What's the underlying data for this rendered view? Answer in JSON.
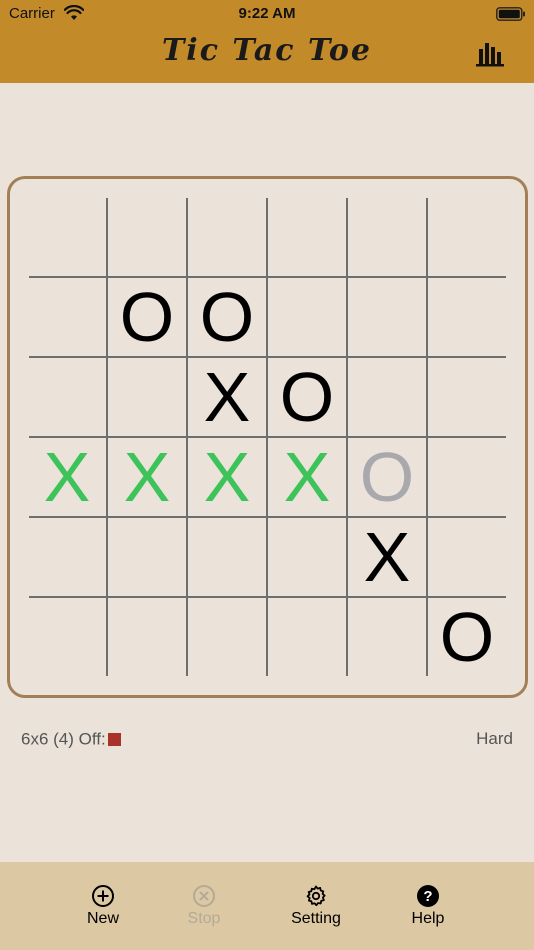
{
  "status_bar": {
    "carrier": "Carrier",
    "time": "9:22 AM"
  },
  "header": {
    "title": "Tic Tac Toe",
    "stats_icon": "bar-chart-icon",
    "background": "#c38a2a"
  },
  "board": {
    "size": 6,
    "cells": [
      [
        "",
        "",
        "",
        "",
        "",
        ""
      ],
      [
        "",
        "O",
        "O",
        "",
        "",
        ""
      ],
      [
        "",
        "",
        "X",
        "O",
        "",
        ""
      ],
      [
        "X",
        "X",
        "X",
        "X",
        "O",
        ""
      ],
      [
        "",
        "",
        "",
        "",
        "X",
        ""
      ],
      [
        "",
        "",
        "",
        "",
        "",
        "O"
      ]
    ],
    "highlight": [
      [
        3,
        0
      ],
      [
        3,
        1
      ],
      [
        3,
        2
      ],
      [
        3,
        3
      ]
    ],
    "last_move": [
      3,
      4
    ],
    "colors": {
      "mark": "#000000",
      "win": "#3cc35a",
      "last_move": "#a9a9ad",
      "grid": "#6e6e6e",
      "frame": "#a37f58"
    }
  },
  "info": {
    "mode": "6x6 (4) Off:",
    "off_color": "#a8332a",
    "difficulty": "Hard"
  },
  "toolbar": {
    "new": {
      "label": "New",
      "icon": "plus-circle-icon"
    },
    "stop": {
      "label": "Stop",
      "icon": "x-circle-icon",
      "enabled": false
    },
    "setting": {
      "label": "Setting",
      "icon": "gear-icon"
    },
    "help": {
      "label": "Help",
      "icon": "question-circle-icon"
    }
  }
}
